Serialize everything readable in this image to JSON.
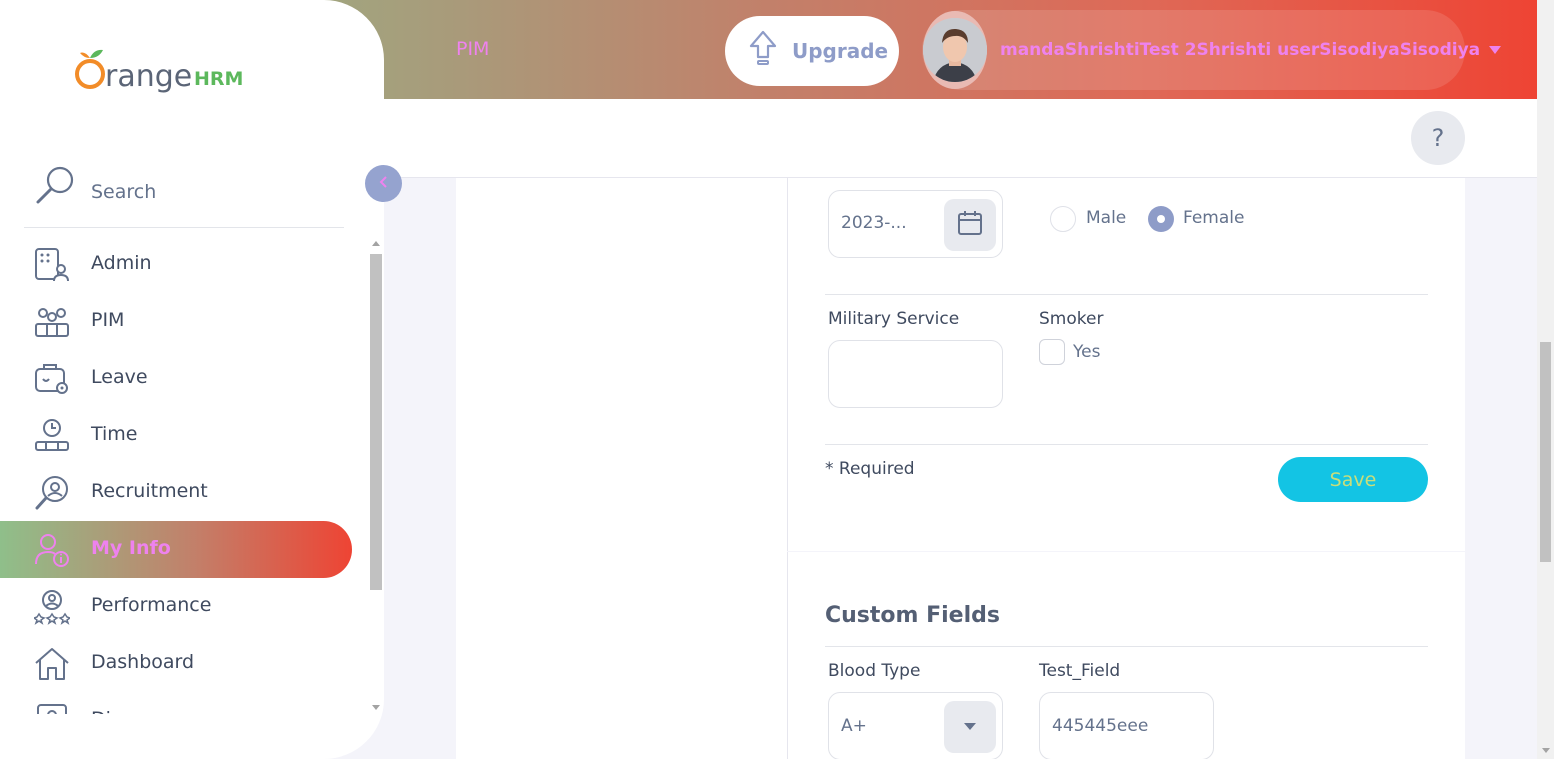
{
  "header": {
    "module_title": "PIM",
    "upgrade_label": "Upgrade",
    "user_name": "mandaShrishtiTest 2Shrishti userSisodiyaSisodiya",
    "help_label": "?"
  },
  "sidebar": {
    "search_label": "Search",
    "items": [
      {
        "label": "Admin",
        "icon": "admin-icon"
      },
      {
        "label": "PIM",
        "icon": "pim-icon"
      },
      {
        "label": "Leave",
        "icon": "leave-icon"
      },
      {
        "label": "Time",
        "icon": "time-icon"
      },
      {
        "label": "Recruitment",
        "icon": "recruitment-icon"
      },
      {
        "label": "My Info",
        "icon": "my-info-icon",
        "active": true
      },
      {
        "label": "Performance",
        "icon": "performance-icon"
      },
      {
        "label": "Dashboard",
        "icon": "dashboard-icon"
      },
      {
        "label": "Di",
        "icon": "directory-icon"
      }
    ]
  },
  "form": {
    "date_value": "2023-...",
    "gender_options": [
      "Male",
      "Female"
    ],
    "gender_selected": "Female",
    "military_label": "Military Service",
    "military_value": "",
    "smoker_label": "Smoker",
    "smoker_option": "Yes",
    "smoker_checked": false,
    "required_note": "* Required",
    "save_label": "Save"
  },
  "custom_fields": {
    "title": "Custom Fields",
    "blood_type_label": "Blood Type",
    "blood_type_value": "A+",
    "test_field_label": "Test_Field",
    "test_field_value": "445445eee"
  },
  "colors": {
    "accent": "#ee82ee",
    "save_button": "#13c4e4",
    "radio_selected": "#8e9cc8",
    "header_gradient_start": "#8fbf8a",
    "header_gradient_end": "#ee4434"
  }
}
